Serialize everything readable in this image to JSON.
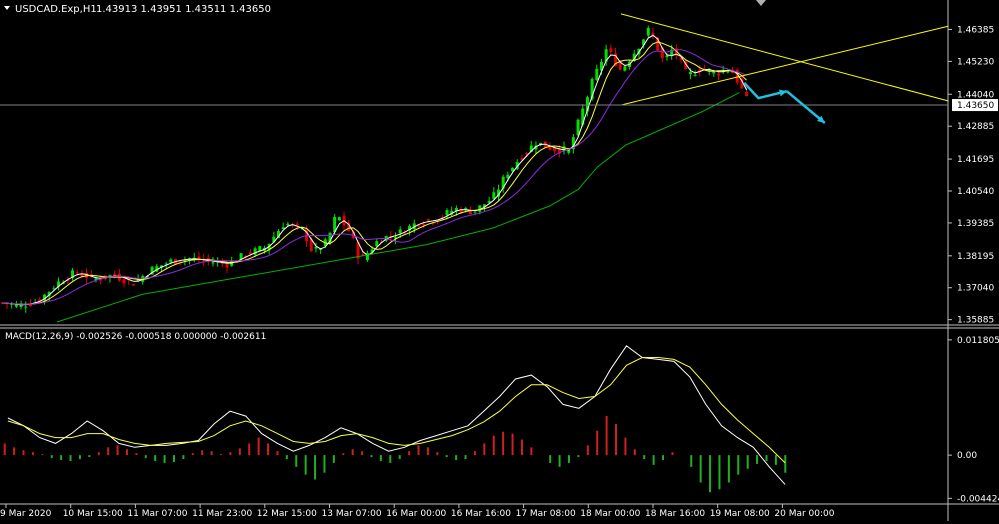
{
  "header": {
    "symbol_label": "USDCAD.Exp,H1",
    "ohlc": "1.43913 1.43951 1.43511 1.43650"
  },
  "macd_header": "MACD(12,26,9) -0.002526 -0.000518 0.000000 -0.002611",
  "colors": {
    "background": "#000000",
    "bull": "#00e000",
    "bear": "#e00000",
    "hist_up": "#d02020",
    "hist_down": "#20b020",
    "ma_fast": "#ffffff",
    "ma_mid": "#ffff40",
    "ma_slow": "#8a2be2",
    "ma_long": "#00b000",
    "trendline": "#ffff00",
    "arrow": "#20c0e0",
    "current_price_line": "#808080"
  },
  "chart_data": [
    {
      "type": "candlestick",
      "series": "USDCAD H1",
      "x_ticks": [
        "9 Mar 2020",
        "10 Mar 15:00",
        "11 Mar 07:00",
        "11 Mar 23:00",
        "12 Mar 15:00",
        "13 Mar 07:00",
        "16 Mar 00:00",
        "16 Mar 16:00",
        "17 Mar 08:00",
        "18 Mar 00:00",
        "18 Mar 16:00",
        "19 Mar 08:00",
        "20 Mar 00:00"
      ],
      "y_ticks": [
        "1.46385",
        "1.45230",
        "1.44040",
        "1.42885",
        "1.41695",
        "1.40540",
        "1.39385",
        "1.38195",
        "1.37040",
        "1.35885"
      ],
      "ylim": [
        1.358,
        1.468
      ],
      "current_price": "1.43650",
      "trendlines": [
        {
          "from": [
            0.655,
            1.4695
          ],
          "to": [
            1.0,
            1.438
          ]
        },
        {
          "from": [
            0.655,
            1.4365
          ],
          "to": [
            1.0,
            1.465
          ]
        }
      ],
      "projection_arrows": [
        {
          "points": [
            [
              0.785,
              1.4445
            ],
            [
              0.8,
              1.439
            ],
            [
              0.83,
              1.4415
            ]
          ]
        },
        {
          "points": [
            [
              0.83,
              1.4415
            ],
            [
              0.87,
              1.43
            ]
          ]
        }
      ],
      "close_path": [
        [
          0.0,
          1.365
        ],
        [
          0.02,
          1.364
        ],
        [
          0.04,
          1.3655
        ],
        [
          0.06,
          1.372
        ],
        [
          0.08,
          1.376
        ],
        [
          0.1,
          1.3735
        ],
        [
          0.12,
          1.375
        ],
        [
          0.14,
          1.372
        ],
        [
          0.16,
          1.377
        ],
        [
          0.18,
          1.38
        ],
        [
          0.2,
          1.381
        ],
        [
          0.22,
          1.38
        ],
        [
          0.24,
          1.379
        ],
        [
          0.26,
          1.3825
        ],
        [
          0.28,
          1.385
        ],
        [
          0.3,
          1.394
        ],
        [
          0.32,
          1.391
        ],
        [
          0.33,
          1.383
        ],
        [
          0.345,
          1.387
        ],
        [
          0.355,
          1.397
        ],
        [
          0.37,
          1.39
        ],
        [
          0.38,
          1.38
        ],
        [
          0.4,
          1.388
        ],
        [
          0.42,
          1.39
        ],
        [
          0.44,
          1.394
        ],
        [
          0.46,
          1.395
        ],
        [
          0.48,
          1.399
        ],
        [
          0.5,
          1.398
        ],
        [
          0.52,
          1.403
        ],
        [
          0.535,
          1.412
        ],
        [
          0.55,
          1.418
        ],
        [
          0.565,
          1.423
        ],
        [
          0.585,
          1.4205
        ],
        [
          0.6,
          1.42
        ],
        [
          0.61,
          1.43
        ],
        [
          0.625,
          1.445
        ],
        [
          0.64,
          1.457
        ],
        [
          0.655,
          1.449
        ],
        [
          0.67,
          1.456
        ],
        [
          0.685,
          1.464
        ],
        [
          0.7,
          1.452
        ],
        [
          0.71,
          1.457
        ],
        [
          0.725,
          1.447
        ],
        [
          0.74,
          1.45
        ],
        [
          0.755,
          1.448
        ],
        [
          0.77,
          1.45
        ],
        [
          0.78,
          1.444
        ],
        [
          0.79,
          1.4365
        ]
      ],
      "ma_long_path": [
        [
          0.06,
          1.358
        ],
        [
          0.15,
          1.368
        ],
        [
          0.25,
          1.374
        ],
        [
          0.35,
          1.38
        ],
        [
          0.45,
          1.386
        ],
        [
          0.52,
          1.392
        ],
        [
          0.58,
          1.4
        ],
        [
          0.61,
          1.406
        ],
        [
          0.63,
          1.414
        ],
        [
          0.66,
          1.422
        ],
        [
          0.7,
          1.428
        ],
        [
          0.74,
          1.434
        ],
        [
          0.78,
          1.441
        ]
      ]
    },
    {
      "type": "macd",
      "name": "MACD(12,26,9)",
      "y_ticks": [
        "0.011805",
        "0.00",
        "-0.004424"
      ],
      "ylim": [
        -0.0048,
        0.0122
      ],
      "histogram": [
        0.0012,
        0.0008,
        0.0005,
        0.0003,
        0.0001,
        -0.0003,
        -0.0005,
        -0.0006,
        -0.0004,
        -0.0002,
        0.0003,
        0.0008,
        0.001,
        0.0006,
        0.0002,
        -0.0003,
        -0.0006,
        -0.0008,
        -0.0007,
        -0.0004,
        0.0002,
        0.0005,
        0.0004,
        0.0001,
        0.0003,
        0.0007,
        0.0012,
        0.0018,
        0.0012,
        0.0004,
        -0.0004,
        -0.0012,
        -0.002,
        -0.0025,
        -0.0018,
        -0.0008,
        0.0002,
        0.0006,
        0.0004,
        -0.0002,
        -0.0006,
        -0.0008,
        -0.0004,
        0.0004,
        0.001,
        0.0008,
        0.0003,
        -0.0002,
        -0.0005,
        -0.0004,
        0.0004,
        0.0012,
        0.002,
        0.0024,
        0.0022,
        0.0016,
        0.0008,
        0.0,
        -0.0008,
        -0.0012,
        -0.0008,
        -0.0002,
        0.001,
        0.0025,
        0.004,
        0.0032,
        0.0018,
        0.0006,
        -0.0004,
        -0.001,
        -0.0005,
        0.0003,
        0.0,
        -0.0012,
        -0.0028,
        -0.0038,
        -0.0035,
        -0.0028,
        -0.002,
        -0.0014,
        -0.0009,
        -0.0006,
        -0.001,
        -0.0018
      ],
      "macd_line": [
        0.0038,
        0.003,
        0.0018,
        0.0012,
        0.0022,
        0.0035,
        0.0025,
        0.0012,
        0.0008,
        0.001,
        0.001,
        0.0012,
        0.0015,
        0.0032,
        0.0045,
        0.004,
        0.0022,
        0.0012,
        0.0004,
        0.001,
        0.0018,
        0.0028,
        0.0022,
        0.0012,
        0.0004,
        0.0008,
        0.0015,
        0.002,
        0.0025,
        0.003,
        0.0045,
        0.006,
        0.0078,
        0.0082,
        0.007,
        0.0052,
        0.0048,
        0.006,
        0.0088,
        0.0112,
        0.01,
        0.0098,
        0.0096,
        0.008,
        0.0052,
        0.003,
        0.0018,
        0.0008,
        -0.0012,
        -0.003
      ],
      "signal_line": [
        0.0035,
        0.003,
        0.0022,
        0.0018,
        0.0018,
        0.0022,
        0.0022,
        0.0016,
        0.0012,
        0.001,
        0.0012,
        0.0013,
        0.0014,
        0.002,
        0.003,
        0.0035,
        0.003,
        0.0022,
        0.0014,
        0.0012,
        0.0014,
        0.002,
        0.0022,
        0.0018,
        0.0012,
        0.001,
        0.0012,
        0.0016,
        0.002,
        0.0026,
        0.0034,
        0.0045,
        0.006,
        0.0072,
        0.0072,
        0.0064,
        0.0058,
        0.006,
        0.0072,
        0.0092,
        0.01,
        0.01,
        0.0098,
        0.009,
        0.0072,
        0.0052,
        0.0036,
        0.0022,
        0.0008,
        -0.0008
      ]
    }
  ]
}
